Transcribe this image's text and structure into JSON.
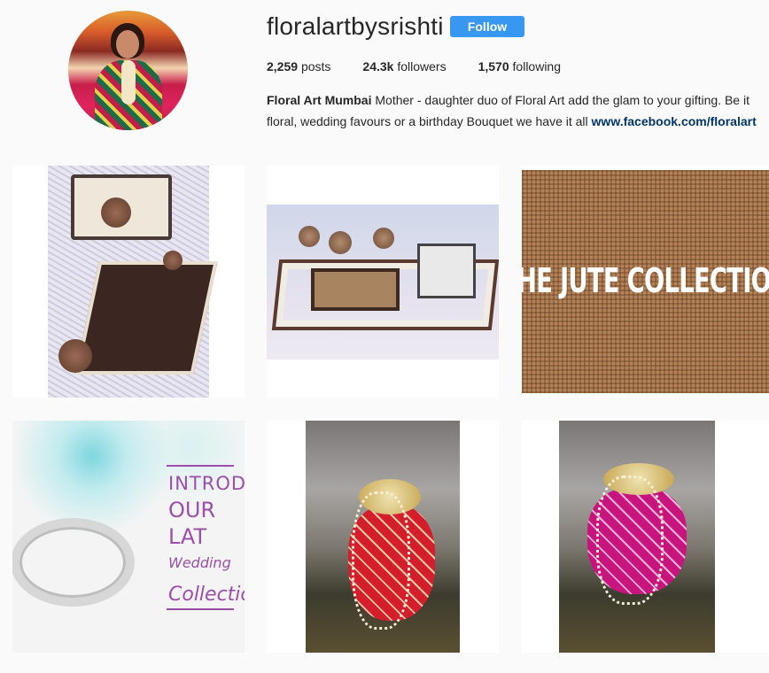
{
  "profile": {
    "username": "floralartbysrishti",
    "follow_label": "Follow",
    "posts_count": "2,259",
    "posts_label": "posts",
    "followers_count": "24.3k",
    "followers_label": "followers",
    "following_count": "1,570",
    "following_label": "following",
    "bio_name": "Floral Art Mumbai",
    "bio_text": "Mother - daughter duo of Floral Art add the glam to your gifting. Be it floral, wedding favours or a birthday Bouquet we have it all",
    "bio_link": "www.facebook.com/floralart"
  },
  "posts": [
    {
      "overlay_text": ""
    },
    {
      "overlay_text": ""
    },
    {
      "overlay_text": "HE JUTE COLLECTIO"
    },
    {
      "overlay_lines": [
        "INTRODUC",
        "OUR LAT",
        "Wedding",
        "Collectio"
      ]
    },
    {
      "overlay_text": ""
    },
    {
      "overlay_text": ""
    }
  ],
  "colors": {
    "accent": "#3897f0",
    "link": "#003569",
    "background": "#fafafa"
  }
}
